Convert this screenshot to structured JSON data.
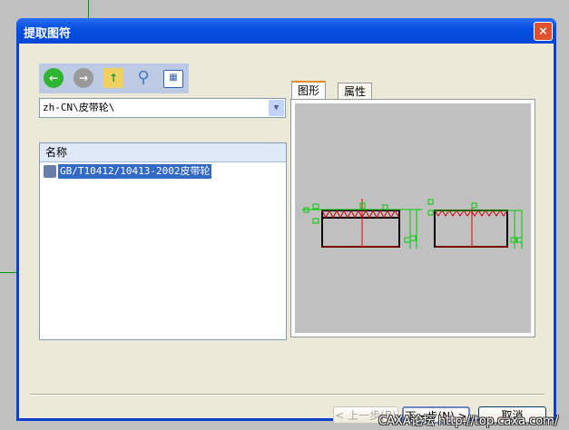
{
  "dialog": {
    "title": "提取图符",
    "close": "×"
  },
  "toolbar": {
    "icons": [
      "back-icon",
      "forward-icon",
      "up-folder-icon",
      "search-icon",
      "view-icon"
    ]
  },
  "path_combo": {
    "value": "zh-CN\\皮带轮\\"
  },
  "list": {
    "header": "名称",
    "items": [
      {
        "label": "GB/T10412/10413-2002皮带轮",
        "selected": true
      }
    ]
  },
  "tabs": [
    {
      "label": "图形",
      "active": true
    },
    {
      "label": "属性",
      "active": false
    }
  ],
  "buttons": {
    "back": "< 上一步(B)",
    "next": "下一步(N) >",
    "cancel": "取消"
  },
  "watermark": "CAXA论坛 http://top.caxa.com/"
}
